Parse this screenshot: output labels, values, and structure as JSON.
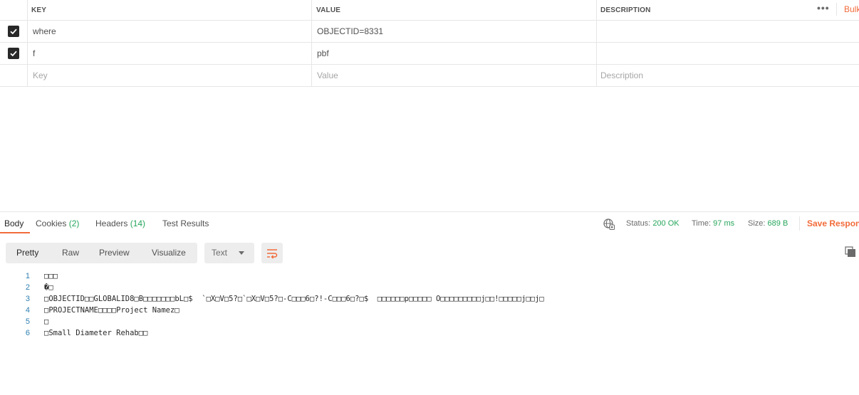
{
  "params": {
    "headers": {
      "key": "KEY",
      "value": "VALUE",
      "description": "DESCRIPTION"
    },
    "more_icon": "more-horizontal-icon",
    "bulk_edit_label": "Bulk",
    "rows": [
      {
        "checked": true,
        "key": "where",
        "value": "OBJECTID=8331",
        "description": ""
      },
      {
        "checked": true,
        "key": "f",
        "value": "pbf",
        "description": ""
      }
    ],
    "placeholders": {
      "key": "Key",
      "value": "Value",
      "description": "Description"
    }
  },
  "response": {
    "tabs": [
      {
        "label": "Body",
        "count": "",
        "active": true
      },
      {
        "label": "Cookies",
        "count": "(2)",
        "active": false
      },
      {
        "label": "Headers",
        "count": "(14)",
        "active": false
      },
      {
        "label": "Test Results",
        "count": "",
        "active": false
      }
    ],
    "status_label": "Status:",
    "status_value": "200 OK",
    "time_label": "Time:",
    "time_value": "97 ms",
    "size_label": "Size:",
    "size_value": "689 B",
    "save_label": "Save Respon"
  },
  "view": {
    "modes": [
      "Pretty",
      "Raw",
      "Preview",
      "Visualize"
    ],
    "active_mode": "Pretty",
    "format": "Text"
  },
  "code_lines": [
    {
      "n": "1",
      "text": "□□□"
    },
    {
      "n": "2",
      "text": "�□"
    },
    {
      "n": "3",
      "text": "□OBJECTID□□GLOBALID8□B□□□□□□□bL□$  `□X□V□5?□`□X□V□5?□-C□□□6□?!-C□□□6□?□$  □□□□□□p□□□□□ O□□□□□□□□□j□□!□□□□□j□□j□"
    },
    {
      "n": "4",
      "text": "□PROJECTNAME□□□□Project Namez□"
    },
    {
      "n": "5",
      "text": "□"
    },
    {
      "n": "6",
      "text": "□Small Diameter Rehab□□"
    }
  ],
  "colors": {
    "accent": "#f26b3a",
    "success": "#26a65b",
    "line_number": "#2f7fb0"
  }
}
